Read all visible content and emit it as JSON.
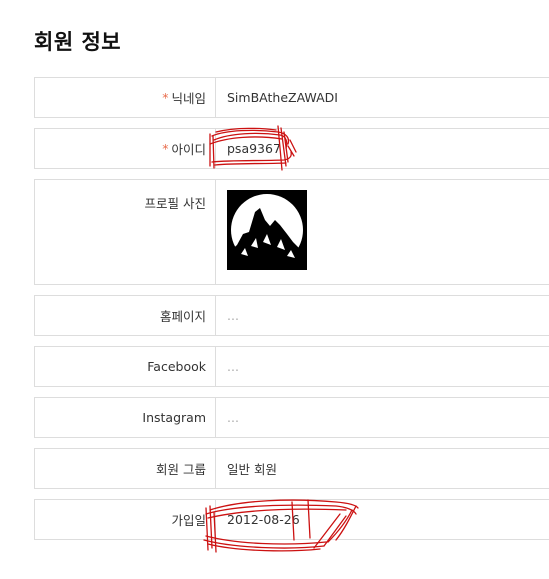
{
  "page": {
    "title": "회원 정보"
  },
  "fields": {
    "nickname": {
      "label": "닉네임",
      "required_mark": "*",
      "value": "SimBAtheZAWADI"
    },
    "user_id": {
      "label": "아이디",
      "required_mark": "*",
      "value": "psa9367"
    },
    "profile_photo": {
      "label": "프로필 사진",
      "image_icon": "mountain-moon-icon"
    },
    "homepage": {
      "label": "홈페이지",
      "value": "..."
    },
    "facebook": {
      "label": "Facebook",
      "value": "..."
    },
    "instagram": {
      "label": "Instagram",
      "value": "..."
    },
    "member_group": {
      "label": "회원 그룹",
      "value": "일반 회원"
    },
    "join_date": {
      "label": "가입일",
      "value": "2012-08-26"
    }
  },
  "colors": {
    "required": "#e96c4c",
    "border": "#dddddd",
    "scribble": "#cc1111"
  }
}
